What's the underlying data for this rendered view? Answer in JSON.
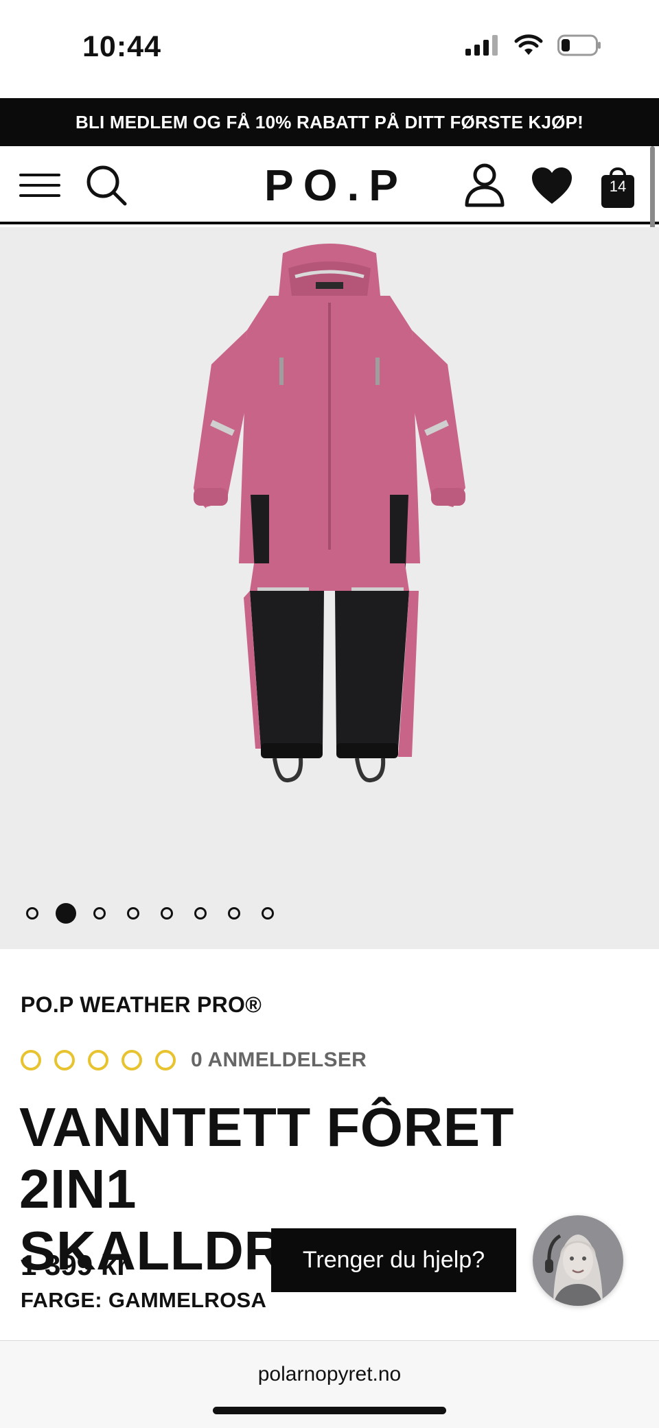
{
  "status_bar": {
    "time": "10:44"
  },
  "promo": {
    "text": "BLI MEDLEM OG FÅ 10% RABATT PÅ DITT FØRSTE KJØP!"
  },
  "header": {
    "logo": "PO.P",
    "cart_count": "14",
    "icons": [
      "menu-icon",
      "search-icon",
      "account-icon",
      "heart-icon",
      "bag-icon"
    ]
  },
  "gallery": {
    "image_count": 8,
    "active_index": 1,
    "colors": {
      "suit_pink": "#c86487",
      "suit_black": "#1c1b1d",
      "background": "#ececed"
    }
  },
  "product": {
    "brand": "PO.P WEATHER PRO®",
    "rating": 0,
    "rating_max": 5,
    "star_color": "#e8c330",
    "reviews_label": "0 ANMELDELSER",
    "title_line1": "VANNTETT FÔRET 2IN1",
    "title_line2": "SKALLDRESS",
    "price": "1 399 kr",
    "color_label": "FARGE: GAMMELROSA"
  },
  "chat": {
    "help_label": "Trenger du hjelp?"
  },
  "browser": {
    "url": "polarnopyret.no"
  }
}
